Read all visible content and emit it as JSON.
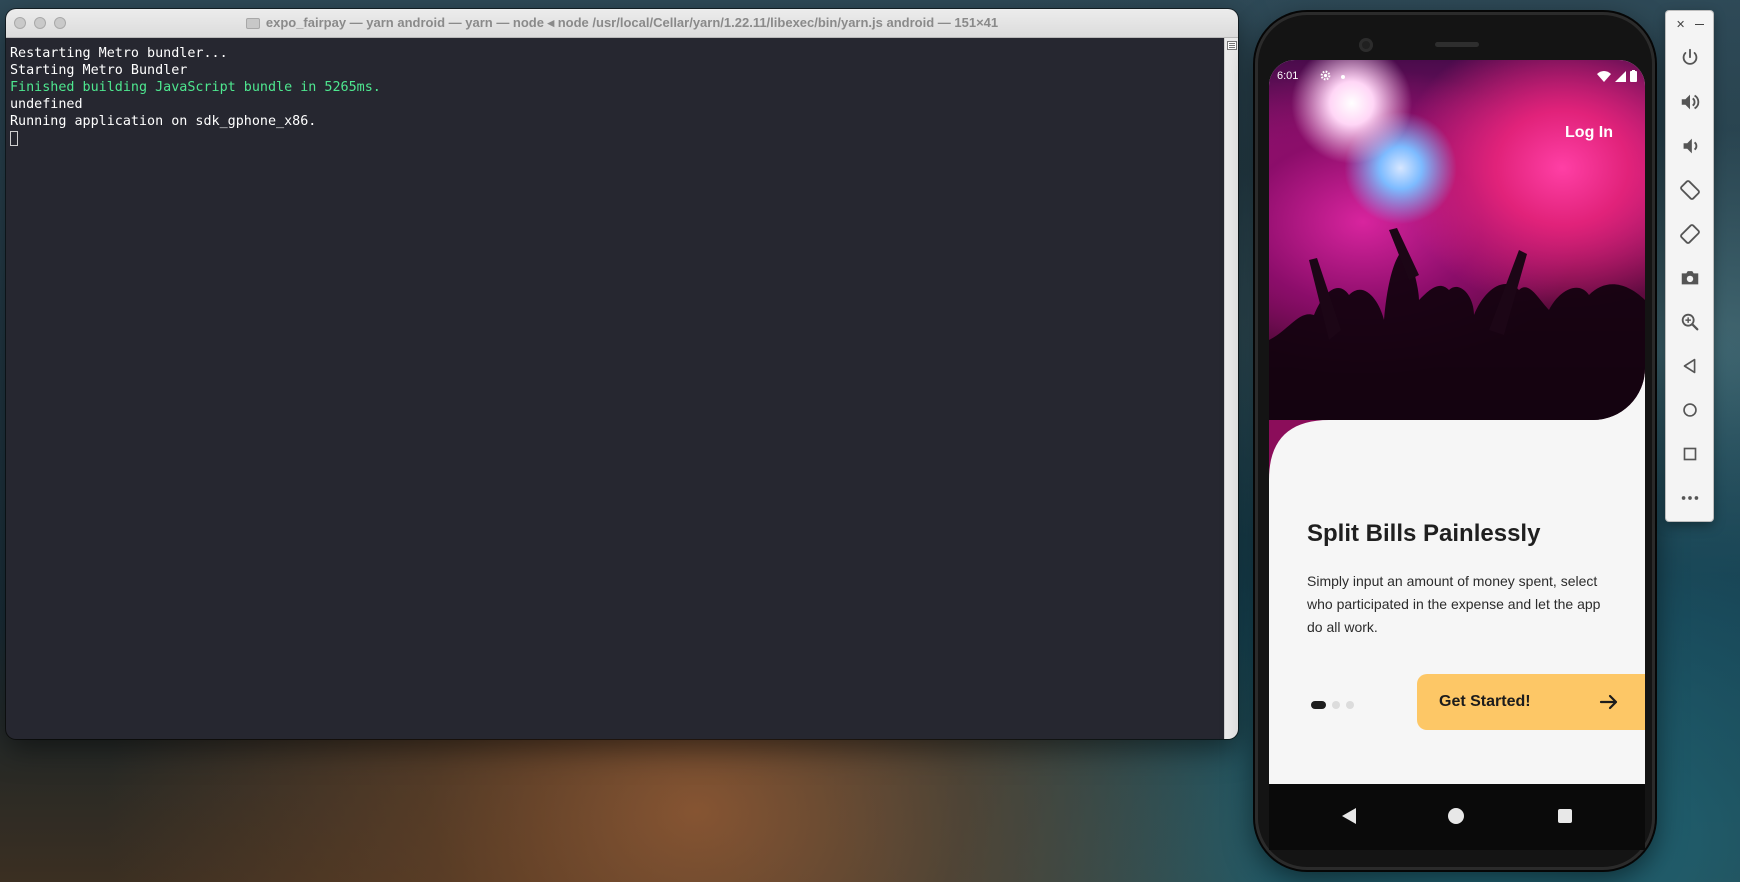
{
  "terminal": {
    "title": "expo_fairpay — yarn android — yarn — node ◂ node /usr/local/Cellar/yarn/1.22.11/libexec/bin/yarn.js android — 151×41",
    "lines": [
      {
        "text": "Restarting Metro bundler...",
        "color": "#ffffff"
      },
      {
        "text": "Starting Metro Bundler",
        "color": "#ffffff"
      },
      {
        "text": "Finished building JavaScript bundle in 5265ms.",
        "color": "#4ee78f"
      },
      {
        "text": "undefined",
        "color": "#ffffff"
      },
      {
        "text": "Running application on sdk_gphone_x86.",
        "color": "#ffffff"
      }
    ]
  },
  "phone": {
    "status": {
      "time": "6:01"
    },
    "login_label": "Log In",
    "title": "Split Bills Painlessly",
    "description": "Simply input an amount of money spent, select who participated in the expense and let the app do all work.",
    "cta_label": "Get Started!",
    "pagination": {
      "total": 3,
      "active": 1
    },
    "accent_color": "#fdc766"
  },
  "emulator": {
    "buttons": [
      "power-icon",
      "volume-up-icon",
      "volume-down-icon",
      "rotate-left-icon",
      "rotate-right-icon",
      "camera-icon",
      "zoom-icon",
      "back-icon",
      "home-icon",
      "overview-icon",
      "more-icon"
    ]
  }
}
